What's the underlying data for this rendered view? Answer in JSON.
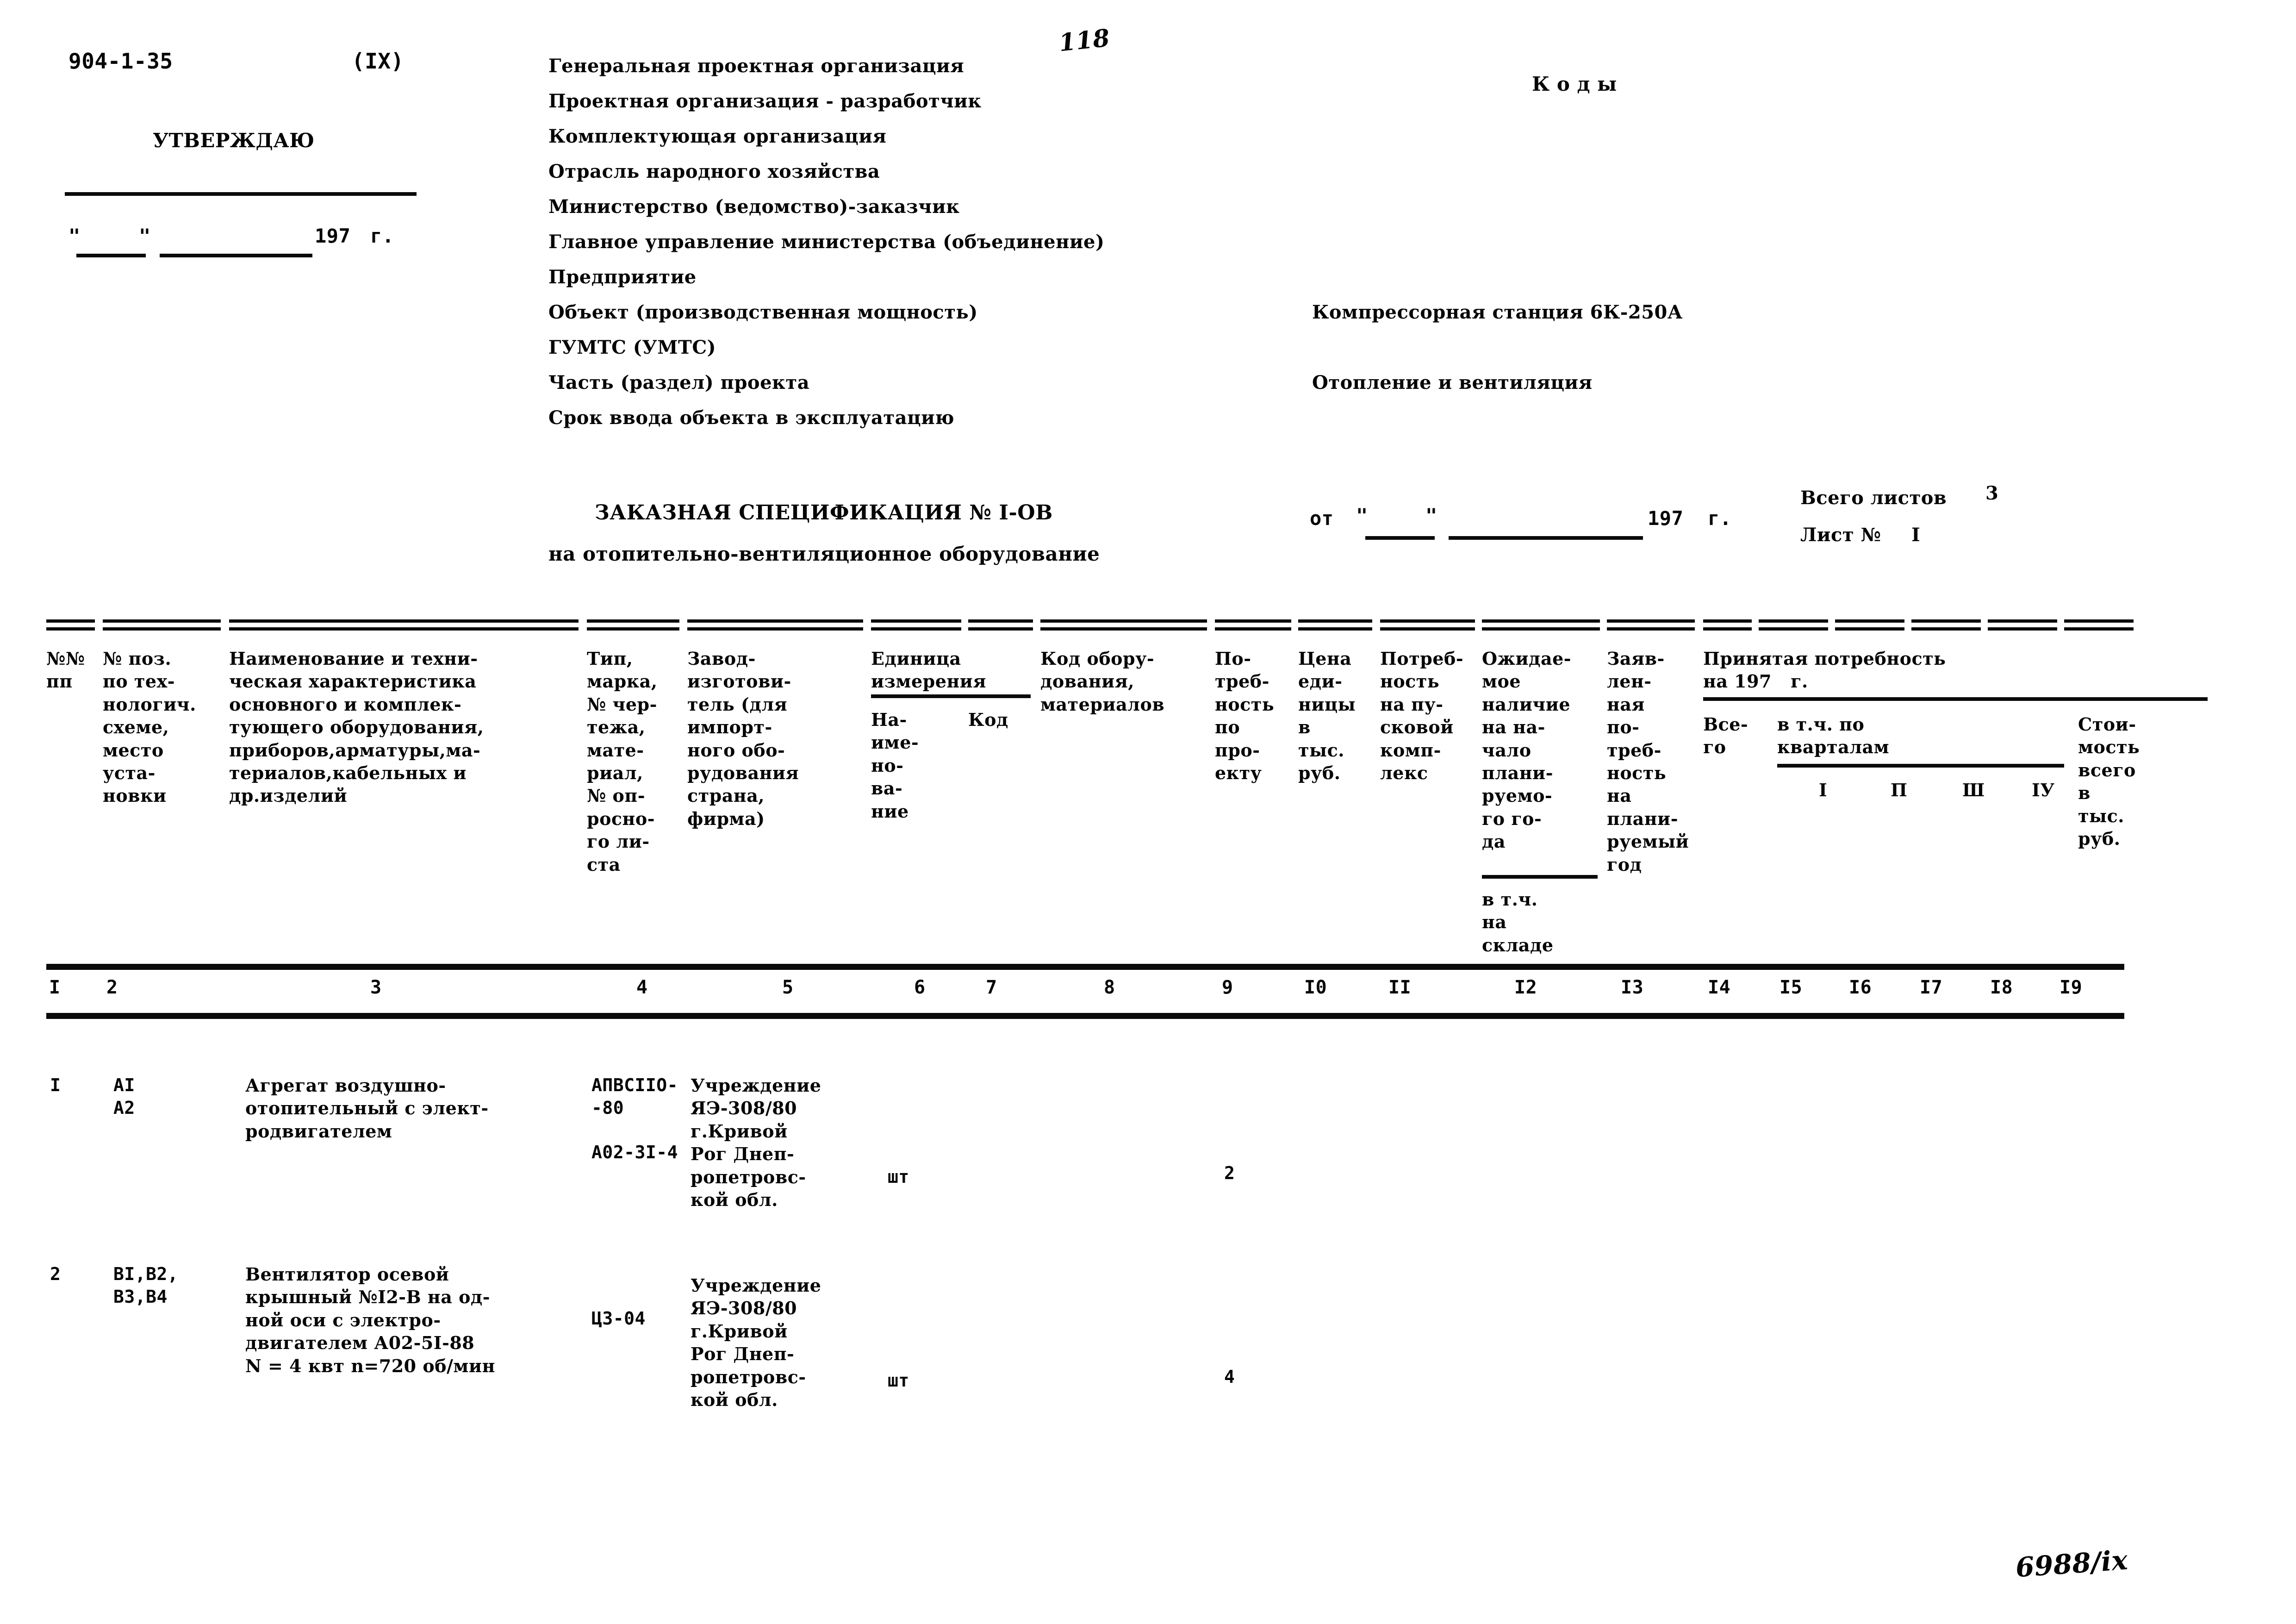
{
  "doc": {
    "code": "904-1-35",
    "series": "(IX)",
    "page_number_handwritten": "118",
    "approve_label": "УТВЕРЖДАЮ",
    "approve_date_quote_open": "\"",
    "approve_date_quote_close": "\"",
    "approve_year": "197",
    "approve_year_suffix": "г.",
    "codes_label": "К о д ы",
    "bottom_mark": "6988/ix"
  },
  "fields": [
    {
      "label": "Генеральная проектная организация",
      "value": ""
    },
    {
      "label": "Проектная организация - разработчик",
      "value": ""
    },
    {
      "label": "Комплектующая организация",
      "value": ""
    },
    {
      "label": "Отрасль народного хозяйства",
      "value": ""
    },
    {
      "label": "Министерство (ведомство)-заказчик",
      "value": ""
    },
    {
      "label": "Главное управление министерства (объединение)",
      "value": ""
    },
    {
      "label": "Предприятие",
      "value": ""
    },
    {
      "label": "Объект (производственная мощность)",
      "value": "Компрессорная станция 6К-250А"
    },
    {
      "label": "ГУМТС (УМТС)",
      "value": ""
    },
    {
      "label": "Часть (раздел) проекта",
      "value": "Отопление и вентиляция"
    },
    {
      "label": "Срок ввода объекта в эксплуатацию",
      "value": ""
    }
  ],
  "title": {
    "line1": "ЗАКАЗНАЯ СПЕЦИФИКАЦИЯ № I-ОВ",
    "line2": "на отопительно-вентиляционное оборудование",
    "date_prefix": "от",
    "date_quote_open": "\"",
    "date_quote_close": "\"",
    "date_year": "197",
    "date_year_suffix": "г.",
    "total_sheets_label": "Всего листов",
    "total_sheets_value": "3",
    "sheet_label": "Лист №",
    "sheet_value": "I"
  },
  "table": {
    "headers": {
      "c1": "№№\nпп",
      "c2": "№ поз.\nпо тех-\nнологич.\nсхеме,\nместо\nуста-\nновки",
      "c3": "Наименование и техни-\nческая характеристика\nосновного и комплек-\nтующего оборудования,\nприборов,арматуры,ма-\nтериалов,кабельных и\nдр.изделий",
      "c4": "Тип,\nмарка,\n№ чер-\nтежа,\nмате-\nриал,\n№ оп-\nросно-\nго ли-\nста",
      "c5": "Завод-\nизготови-\nтель (для\nимпорт-\nного обо-\nрудования\nстрана,\nфирма)",
      "c6_group": "Единица\nизмерения",
      "c6": "На-\nиме-\nно-\nва-\nние",
      "c7": "Код",
      "c8": "Код обору-\nдования,\nматериалов",
      "c9": "По-\nтреб-\nность\nпо\nпро-\nекту",
      "c10": "Цена\nеди-\nницы\nв\nтыс.\nруб.",
      "c11": "Потреб-\nность\nна пу-\nсковой\nкомп-\nлекс",
      "c12": "Ожидае-\nмое\nналичие\nна на-\nчало\nплани-\nруемо-\nго го-\nда",
      "c12b": "в т.ч.\nна\nскладе",
      "c13": "Заяв-\nлен-\nная\nпо-\nтреб-\nность\nна\nплани-\nруемый\nгод",
      "c14_19_group": "Принятая потребность\nна 197   г.",
      "c14": "Все-\nго",
      "c15_18_group": "в т.ч. по\nкварталам",
      "c15": "I",
      "c16": "П",
      "c17": "Ш",
      "c18": "IУ",
      "c19": "Стои-\nмость\nвсего\nв\nтыс.\nруб."
    },
    "column_numbers": [
      "I",
      "2",
      "3",
      "4",
      "5",
      "6",
      "7",
      "8",
      "9",
      "I0",
      "II",
      "I2",
      "I3",
      "I4",
      "I5",
      "I6",
      "I7",
      "I8",
      "I9"
    ],
    "rows": [
      {
        "c1": "I",
        "c2": "АI\nА2",
        "c3": "Агрегат воздушно-\nотопительный с элект-\nродвигателем",
        "c4": "АПВСIIО-\n-80",
        "c4b": "А02-3I-4",
        "c5": "Учреждение\nЯЭ-308/80\nг.Кривой\nРог Днеп-\nропетровс-\nкой обл.",
        "c6": "шт",
        "c7": "",
        "c8": "",
        "c9": "2",
        "c10": "",
        "c11": "",
        "c12": "",
        "c13": "",
        "c14": "",
        "c15": "",
        "c16": "",
        "c17": "",
        "c18": "",
        "c19": ""
      },
      {
        "c1": "2",
        "c2": "ВI,В2,\nВ3,В4",
        "c3": "Вентилятор осевой\nкрышный №I2-В на од-\nной оси с электро-\nдвигателем А02-5I-88\nN = 4 квт n=720 об/мин",
        "c4": "",
        "c4b": "ЦЗ-04",
        "c5": "Учреждение\nЯЭ-308/80\nг.Кривой\nРог Днеп-\nропетровс-\nкой обл.",
        "c6": "шт",
        "c7": "",
        "c8": "",
        "c9": "4",
        "c10": "",
        "c11": "",
        "c12": "",
        "c13": "",
        "c14": "",
        "c15": "",
        "c16": "",
        "c17": "",
        "c18": "",
        "c19": ""
      }
    ]
  }
}
